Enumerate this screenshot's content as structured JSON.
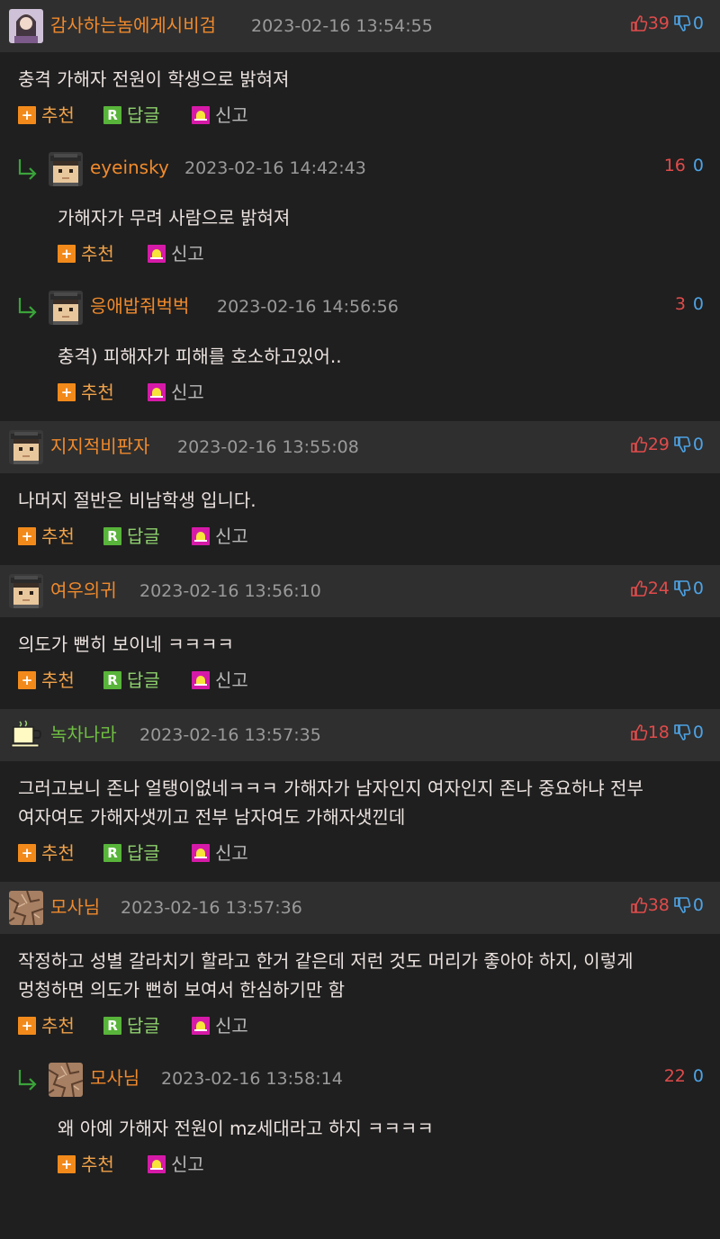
{
  "actions": {
    "recommend": "추천",
    "reply": "답글",
    "report": "신고"
  },
  "colors": {
    "up": "#e04b4b",
    "down": "#4da3e6",
    "nick_orange": "#f08a2c",
    "nick_green": "#6fbf42"
  },
  "comments": [
    {
      "nick": "감사하는놈에게시비검",
      "date": "2023-02-16 13:54:55",
      "up": "39",
      "down": "0",
      "text": "충격 가해자 전원이 학생으로 밝혀져"
    },
    {
      "nick": "eyeinsky",
      "date": "2023-02-16 14:42:43",
      "up": "16",
      "down": "0",
      "text": "가해자가 무려 사람으로 밝혀져"
    },
    {
      "nick": "응애밥줘벅벅",
      "date": "2023-02-16 14:56:56",
      "up": "3",
      "down": "0",
      "text": "충격) 피해자가 피해를 호소하고있어.."
    },
    {
      "nick": "지지적비판자",
      "date": "2023-02-16 13:55:08",
      "up": "29",
      "down": "0",
      "text": "나머지 절반은 비남학생 입니다."
    },
    {
      "nick": "여우의귀",
      "date": "2023-02-16 13:56:10",
      "up": "24",
      "down": "0",
      "text": "의도가 뻔히 보이네 ㅋㅋㅋㅋ"
    },
    {
      "nick": "녹차나라",
      "date": "2023-02-16 13:57:35",
      "up": "18",
      "down": "0",
      "text": "그러고보니 존나 얼탱이없네ㅋㅋㅋ 가해자가 남자인지 여자인지 존나 중요하냐 전부 여자여도 가해자샛끼고 전부 남자여도 가해자샛낀데"
    },
    {
      "nick": "모사님",
      "date": "2023-02-16 13:57:36",
      "up": "38",
      "down": "0",
      "text": "작정하고 성별 갈라치기 할라고 한거 같은데 저런 것도 머리가 좋아야 하지, 이렇게 멍청하면 의도가 뻔히 보여서 한심하기만 함"
    },
    {
      "nick": "모사님",
      "date": "2023-02-16 13:58:14",
      "up": "22",
      "down": "0",
      "text": "왜 아예 가해자 전원이 mz세대라고 하지 ㅋㅋㅋㅋ"
    }
  ]
}
